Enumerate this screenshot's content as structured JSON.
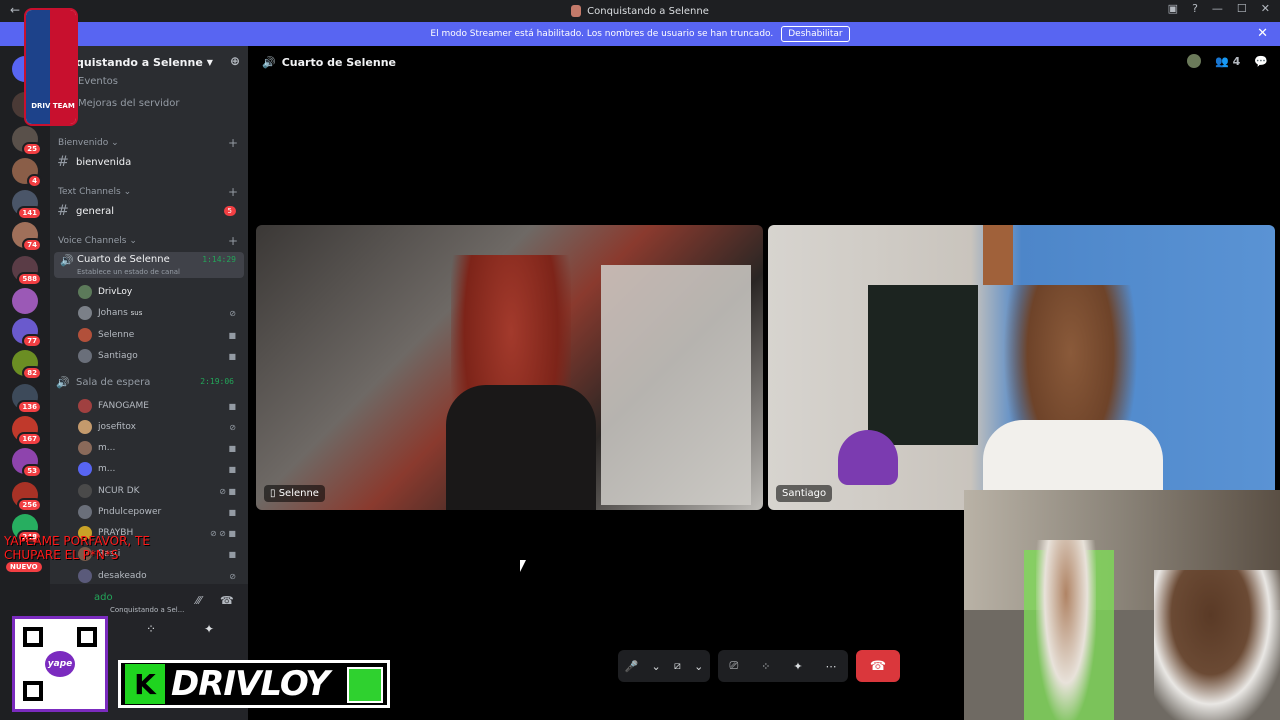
{
  "window": {
    "title": "Conquistando a Selenne"
  },
  "banner": {
    "text": "El modo Streamer está habilitado. Los nombres de usuario se han truncado.",
    "button": "Deshabilitar"
  },
  "guild_badges": [
    "25",
    "4",
    "141",
    "74",
    "588",
    "77",
    "82",
    "136",
    "167",
    "53",
    "256",
    "248"
  ],
  "sidebar": {
    "server_name": "quistando a Selenne",
    "items": [
      "Eventos",
      "Mejoras del servidor"
    ],
    "categories": {
      "bienvenido": "Bienvenido",
      "text": "Text Channels",
      "voice": "Voice Channels"
    },
    "channels": {
      "bienvenida": "bienvenida",
      "general": "general",
      "general_badge": "5"
    },
    "voice_active": {
      "name": "Cuarto de Selenne",
      "time": "1:14:29",
      "status": "Establece un estado de canal"
    },
    "voice_users_1": [
      "DrivLoy",
      "Johans",
      "Selenne",
      "Santiago"
    ],
    "johans_tag": "sus",
    "voice_waiting": {
      "name": "Sala de espera",
      "time": "2:19:06"
    },
    "voice_users_2": [
      "FANOGAME",
      "josefitox",
      "m...",
      "m...",
      "NCUR DK",
      "Pndulcepower",
      "PRAYBH",
      "Rasti",
      "desakeado"
    ],
    "panel": {
      "status": "ado",
      "sub": "Conquistando a Sel..."
    }
  },
  "topbar": {
    "channel": "Cuarto de Selenne",
    "members": "4"
  },
  "video": {
    "left_name": "Selenne",
    "right_name": "Santiago"
  },
  "overlay": {
    "text": "YAPEAME PORFAVOR, TE CHUPARE EL P*N*S",
    "logo": "DRIV TEAM",
    "brand_letter": "K",
    "brand_name": "DRIVLOY",
    "qr_label": "yape",
    "new_badge": "NUEVO"
  },
  "colors": {
    "accent": "#5865f2",
    "danger": "#da373c",
    "online": "#23a559"
  }
}
